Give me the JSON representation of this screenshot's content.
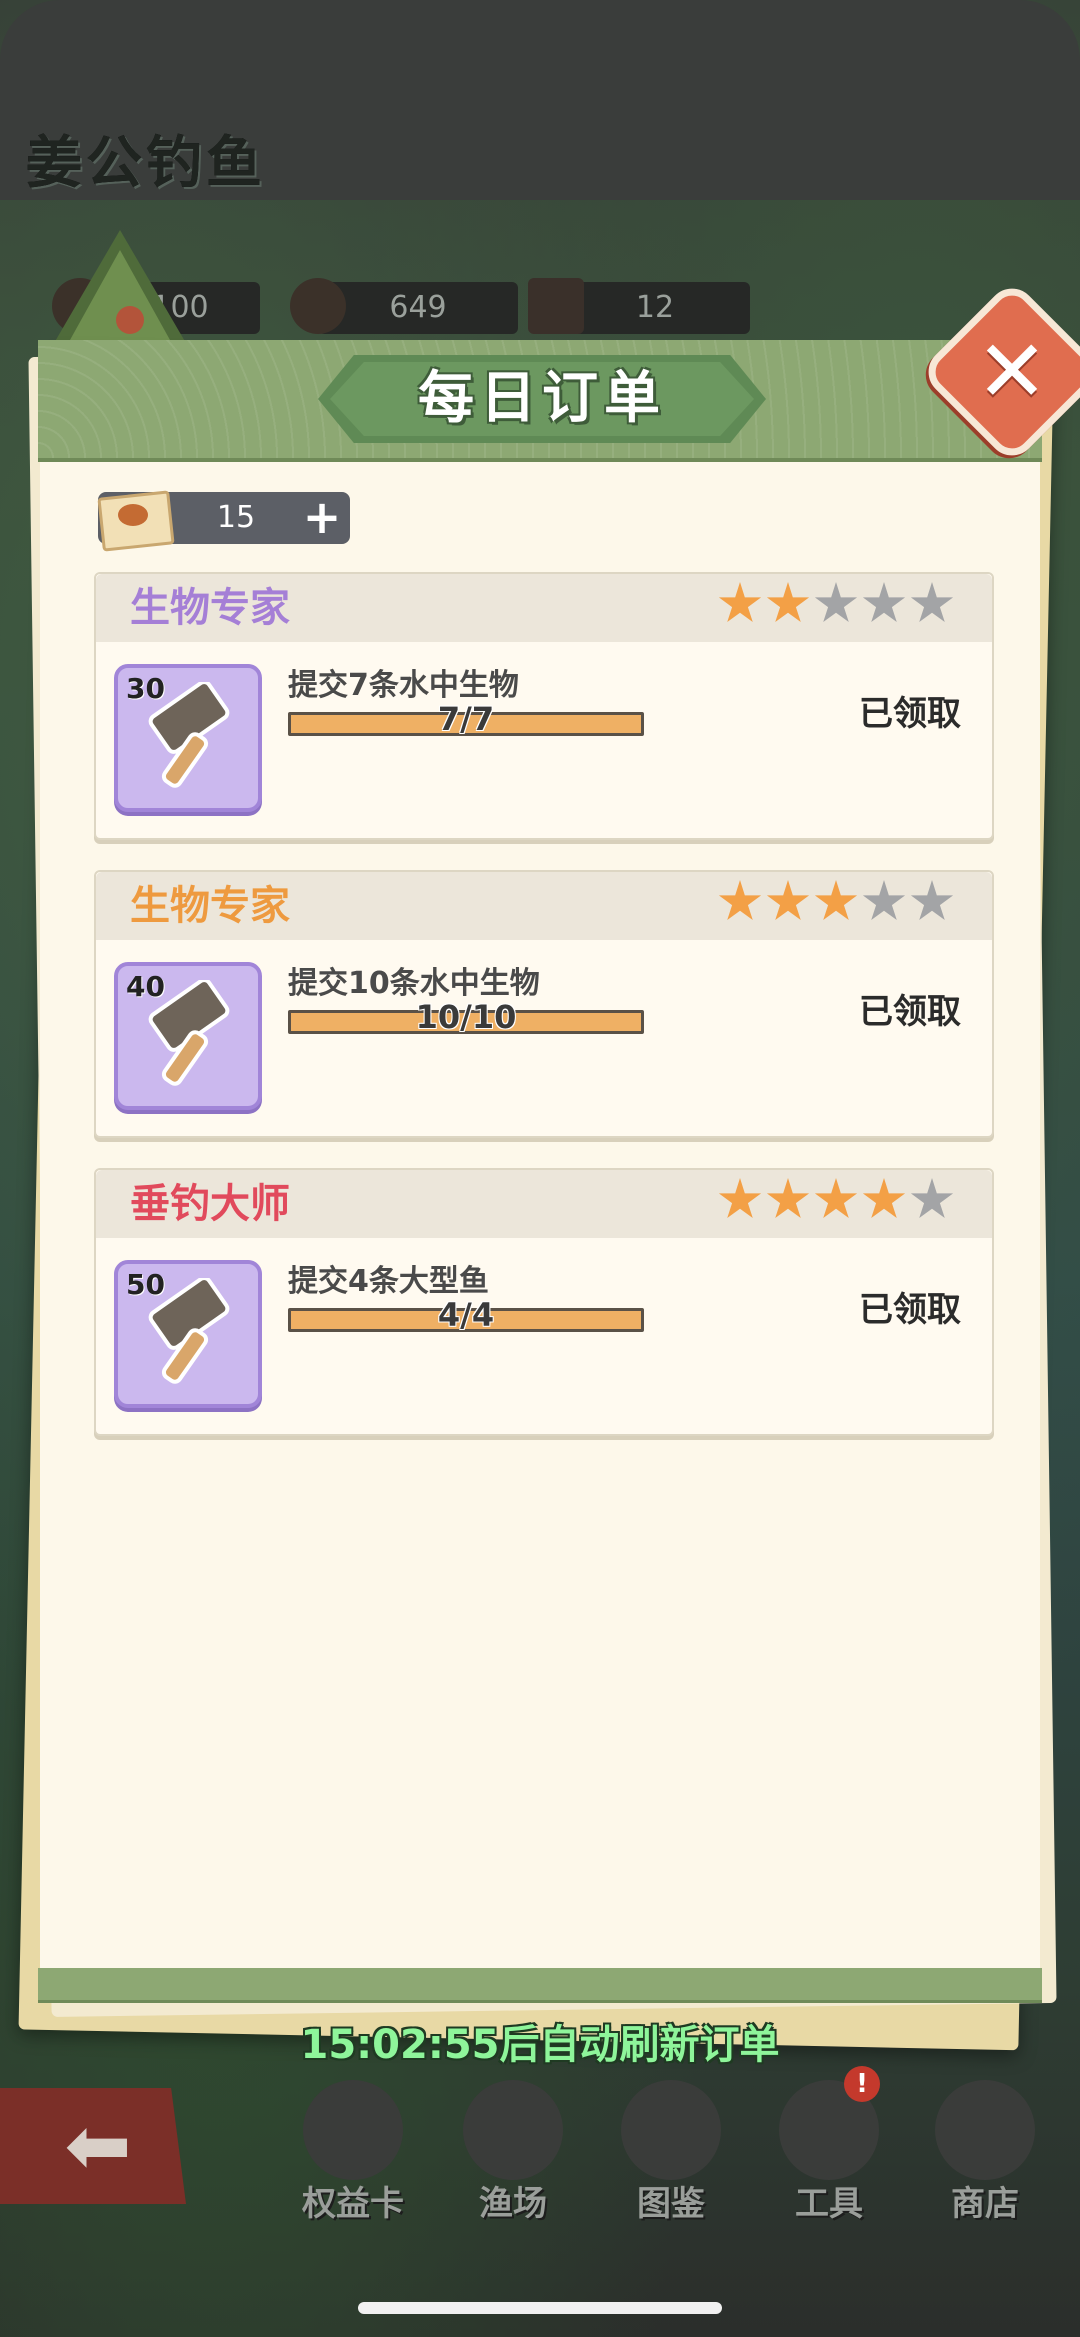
{
  "app": {
    "title": "姜公钓鱼"
  },
  "resources": [
    {
      "icon": "coin-icon",
      "value": "100"
    },
    {
      "icon": "bait-bag-icon",
      "value": "649"
    },
    {
      "icon": "hammer-icon",
      "value": "12"
    }
  ],
  "panel": {
    "title": "每日订单",
    "close_icon": "close-icon",
    "ticket": {
      "icon": "order-ticket-icon",
      "count": "15",
      "add_label": "+"
    }
  },
  "orders": [
    {
      "name": "生物专家",
      "name_color": "#a57fd6",
      "stars_on": 2,
      "stars_total": 5,
      "reward_icon": "hammer-icon",
      "reward_count": "30",
      "task": "提交7条水中生物",
      "progress_label": "7/7",
      "progress": 1.0,
      "status": "已领取"
    },
    {
      "name": "生物专家",
      "name_color": "#ee9a3f",
      "stars_on": 3,
      "stars_total": 5,
      "reward_icon": "hammer-icon",
      "reward_count": "40",
      "task": "提交10条水中生物",
      "progress_label": "10/10",
      "progress": 1.0,
      "status": "已领取"
    },
    {
      "name": "垂钓大师",
      "name_color": "#e14a5c",
      "stars_on": 4,
      "stars_total": 5,
      "reward_icon": "hammer-icon",
      "reward_count": "50",
      "task": "提交4条大型鱼",
      "progress_label": "4/4",
      "progress": 1.0,
      "status": "已领取"
    }
  ],
  "footer": {
    "refresh_text": "15:02:55后自动刷新订单"
  },
  "nav": {
    "back_icon": "back-arrow-icon",
    "items": [
      {
        "label": "权益卡",
        "icon": "privilege-card-icon"
      },
      {
        "label": "渔场",
        "icon": "fishing-ground-icon"
      },
      {
        "label": "图鉴",
        "icon": "fish-guide-icon"
      },
      {
        "label": "工具",
        "icon": "tool-basket-icon",
        "badge": "!"
      },
      {
        "label": "商店",
        "icon": "shop-bag-icon"
      }
    ]
  }
}
